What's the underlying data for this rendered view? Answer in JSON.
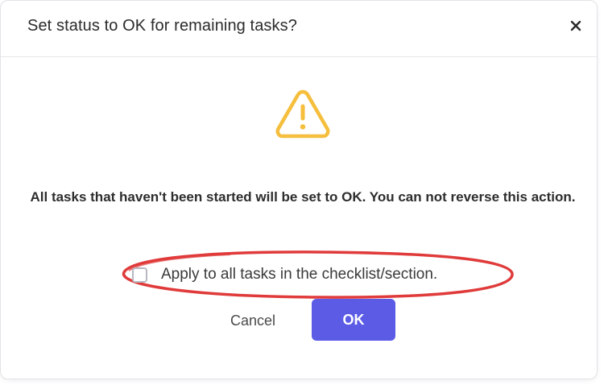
{
  "dialog": {
    "title": "Set status to OK for remaining tasks?",
    "close_icon": "close-icon",
    "warning_icon": "warning-triangle-icon",
    "message": "All tasks that haven't been started will be set to OK. You can not reverse this action.",
    "checkbox": {
      "label": "Apply to all tasks in the checklist/section.",
      "checked": false
    },
    "buttons": {
      "cancel_label": "Cancel",
      "ok_label": "OK"
    }
  },
  "colors": {
    "primary": "#5b5be6",
    "warning": "#f5be3c",
    "highlight_annotation": "#e03a3a"
  }
}
